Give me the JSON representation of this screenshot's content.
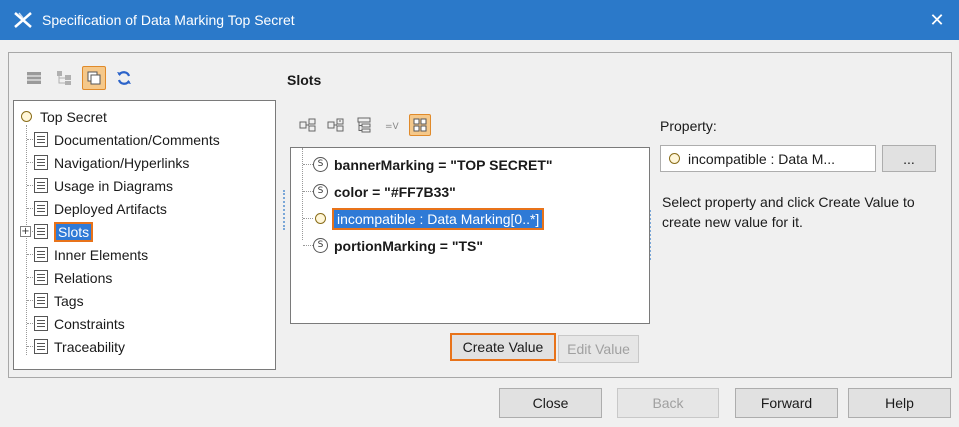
{
  "window": {
    "title": "Specification of Data Marking Top Secret",
    "close_glyph": "✕"
  },
  "left_toolbar": {
    "icons": [
      "grid-icon",
      "tree-view-icon",
      "copy-view-icon",
      "refresh-icon"
    ]
  },
  "tree": {
    "root_label": "Top Secret",
    "items": [
      {
        "label": "Documentation/Comments"
      },
      {
        "label": "Navigation/Hyperlinks"
      },
      {
        "label": "Usage in Diagrams"
      },
      {
        "label": "Deployed Artifacts"
      },
      {
        "label": "Slots",
        "expander": "+"
      },
      {
        "label": "Inner Elements"
      },
      {
        "label": "Relations"
      },
      {
        "label": "Tags"
      },
      {
        "label": "Constraints"
      },
      {
        "label": "Traceability"
      }
    ]
  },
  "slots_panel": {
    "title": "Slots",
    "slots": [
      {
        "label": "bannerMarking = \"TOP SECRET\"",
        "icon_glyph": "S"
      },
      {
        "label": "color = \"#FF7B33\"",
        "icon_glyph": "S"
      },
      {
        "label": "incompatible : Data Marking[0..*]"
      },
      {
        "label": "portionMarking = \"TS\"",
        "icon_glyph": "S"
      }
    ],
    "create_value_label": "Create Value",
    "edit_value_label": "Edit Value"
  },
  "property": {
    "label": "Property:",
    "value": "incompatible : Data M...",
    "browse_label": "...",
    "hint": "Select property and click Create Value to create new value for it."
  },
  "footer": {
    "close_label": "Close",
    "back_label": "Back",
    "forward_label": "Forward",
    "help_label": "Help"
  },
  "colors": {
    "titlebar": "#2b79c9",
    "selection": "#2f7ad6",
    "highlight_border": "#e8731a"
  }
}
